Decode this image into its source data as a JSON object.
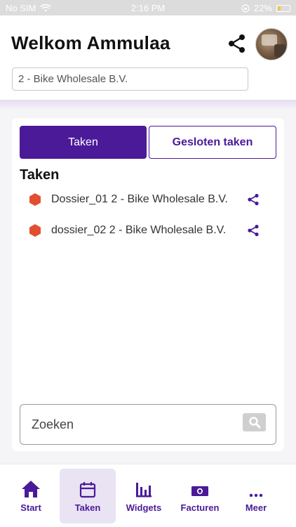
{
  "status_bar": {
    "carrier": "No SIM",
    "time": "2:16 PM",
    "battery": "22%",
    "battery_level": 0.22
  },
  "header": {
    "title": "Welkom Ammulaa",
    "company": "2 - Bike Wholesale B.V."
  },
  "tabs": {
    "active": "Taken",
    "inactive": "Gesloten taken"
  },
  "section_title": "Taken",
  "tasks": [
    {
      "label": "Dossier_01 2 - Bike Wholesale B.V.",
      "status_color": "#e0502f"
    },
    {
      "label": "dossier_02 2 - Bike Wholesale B.V.",
      "status_color": "#e0502f"
    }
  ],
  "search": {
    "placeholder": "Zoeken"
  },
  "nav": [
    {
      "label": "Start",
      "icon": "home-icon"
    },
    {
      "label": "Taken",
      "icon": "calendar-icon",
      "active": true
    },
    {
      "label": "Widgets",
      "icon": "bar-chart-icon"
    },
    {
      "label": "Facturen",
      "icon": "money-icon"
    },
    {
      "label": "Meer",
      "icon": "more-icon"
    }
  ],
  "colors": {
    "primary": "#4a1a99",
    "task_status": "#e0502f"
  }
}
